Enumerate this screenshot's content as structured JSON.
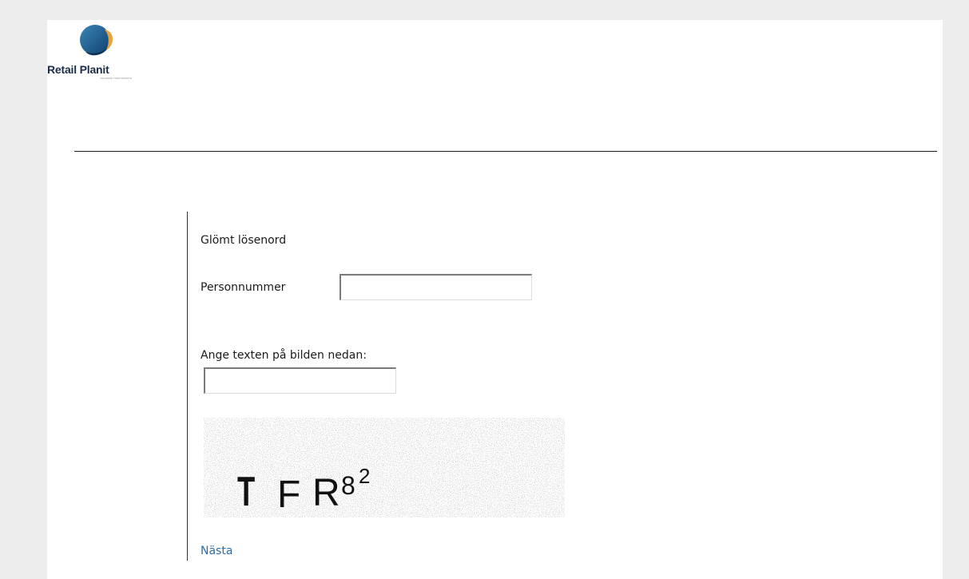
{
  "brand": {
    "name": "Retail Planit",
    "tagline": "TAILORING YOUR GROWTH"
  },
  "form": {
    "title": "Glömt lösenord",
    "personnummer_label": "Personnummer",
    "personnummer_value": "",
    "captcha_label": "Ange texten på bilden nedan:",
    "captcha_value": "",
    "captcha_text": "TFR82",
    "next_link": "Nästa"
  },
  "colors": {
    "background": "#eeedee",
    "link": "#2a6da5",
    "logo_blue": "#1d5a8e",
    "logo_orange": "#e9a23b"
  }
}
